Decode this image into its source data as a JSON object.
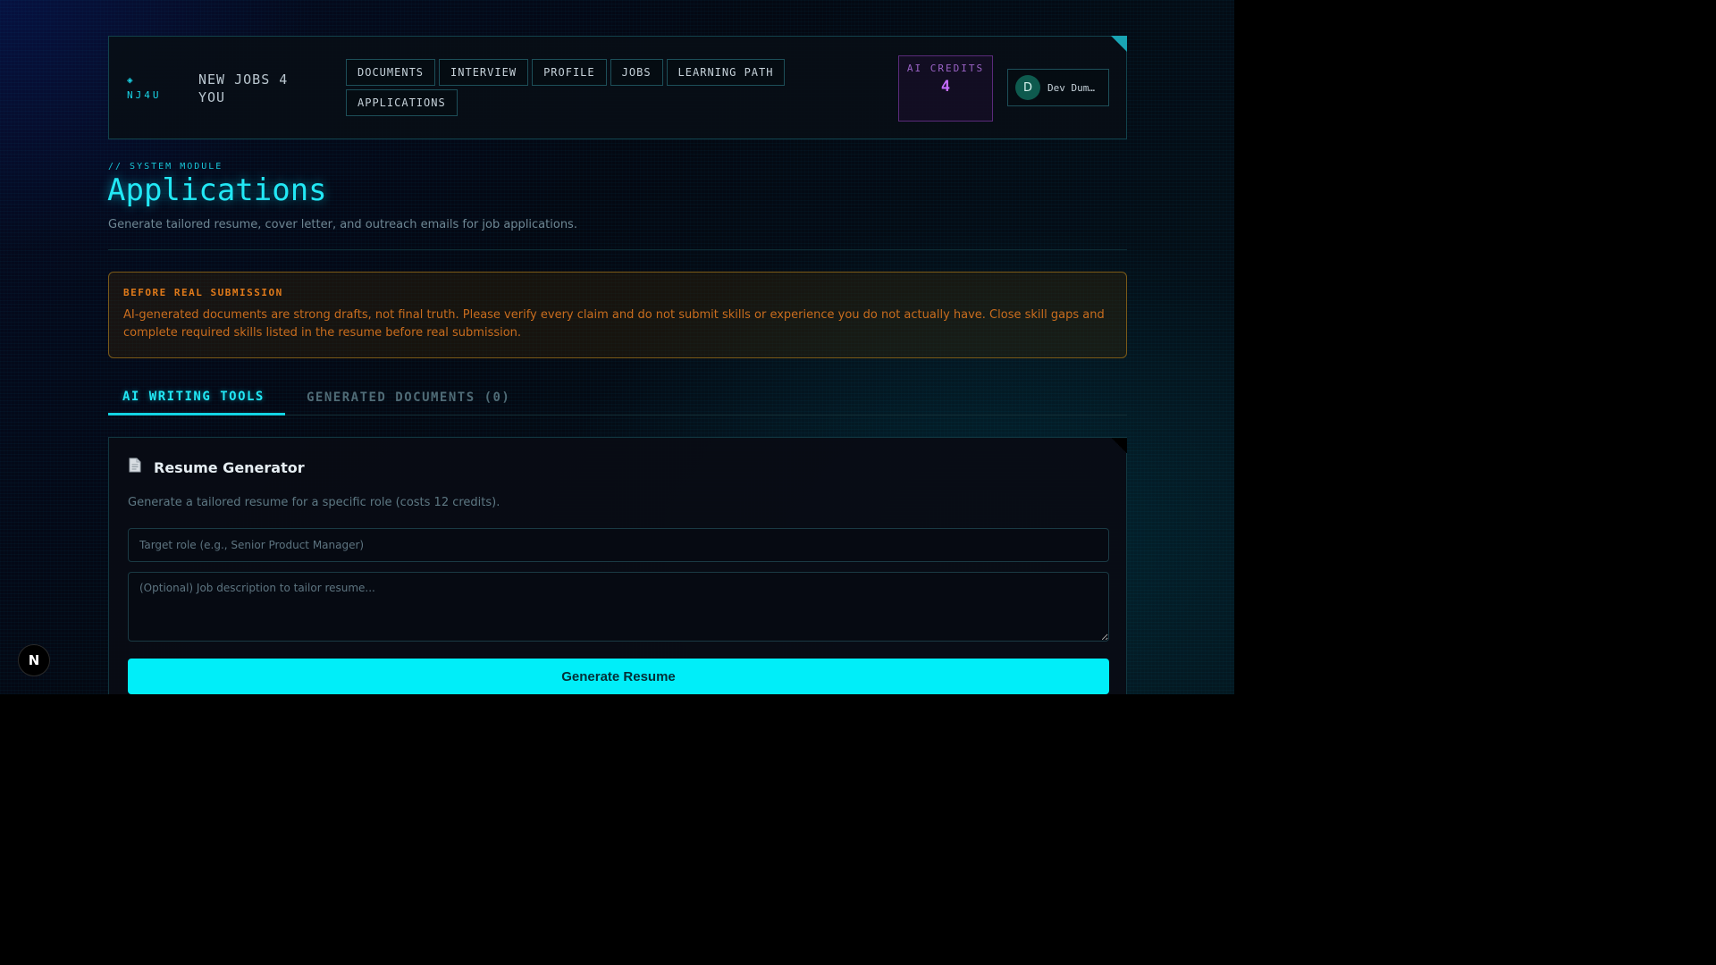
{
  "brand": {
    "logo_text": "◈\nNJ4U",
    "name": "New Jobs 4 You"
  },
  "nav": [
    {
      "label": "DOCUMENTS"
    },
    {
      "label": "INTERVIEW"
    },
    {
      "label": "PROFILE"
    },
    {
      "label": "JOBS"
    },
    {
      "label": "LEARNING PATH"
    },
    {
      "label": "APPLICATIONS"
    }
  ],
  "credits": {
    "label": "AI CREDITS",
    "value": "4"
  },
  "user": {
    "initial": "D",
    "name": "Dev Dum…"
  },
  "page": {
    "kicker": "// SYSTEM MODULE",
    "title": "Applications",
    "subtitle": "Generate tailored resume, cover letter, and outreach emails for job applications."
  },
  "warning": {
    "title": "BEFORE REAL SUBMISSION",
    "text": "AI-generated documents are strong drafts, not final truth. Please verify every claim and do not submit skills or experience you do not actually have. Close skill gaps and complete required skills listed in the resume before real submission."
  },
  "tabs": [
    {
      "label": "AI WRITING TOOLS",
      "active": true
    },
    {
      "label": "GENERATED DOCUMENTS (0)",
      "active": false
    }
  ],
  "resume_card": {
    "icon": "document-icon",
    "title": "Resume Generator",
    "description": "Generate a tailored resume for a specific role (costs 12 credits).",
    "role_placeholder": "Target role (e.g., Senior Product Manager)",
    "jd_placeholder": "(Optional) Job description to tailor resume...",
    "button_label": "Generate Resume"
  },
  "dev_badge": {
    "label": "N"
  },
  "colors": {
    "accent": "#00eef9",
    "warning": "#e07a1a",
    "credits": "#c46cff"
  }
}
